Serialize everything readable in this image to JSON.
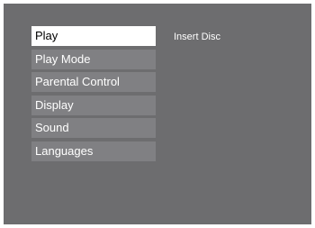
{
  "menu": {
    "items": [
      {
        "label": "Play",
        "selected": true
      },
      {
        "label": "Play Mode",
        "selected": false
      },
      {
        "label": "Parental Control",
        "selected": false
      },
      {
        "label": "Display",
        "selected": false
      },
      {
        "label": "Sound",
        "selected": false
      },
      {
        "label": "Languages",
        "selected": false
      }
    ]
  },
  "status": {
    "message": "Insert Disc"
  },
  "colors": {
    "background": "#6d6d6f",
    "item_background": "#808083",
    "selected_background": "#ffffff",
    "selected_text": "#000000",
    "text": "#ffffff"
  }
}
